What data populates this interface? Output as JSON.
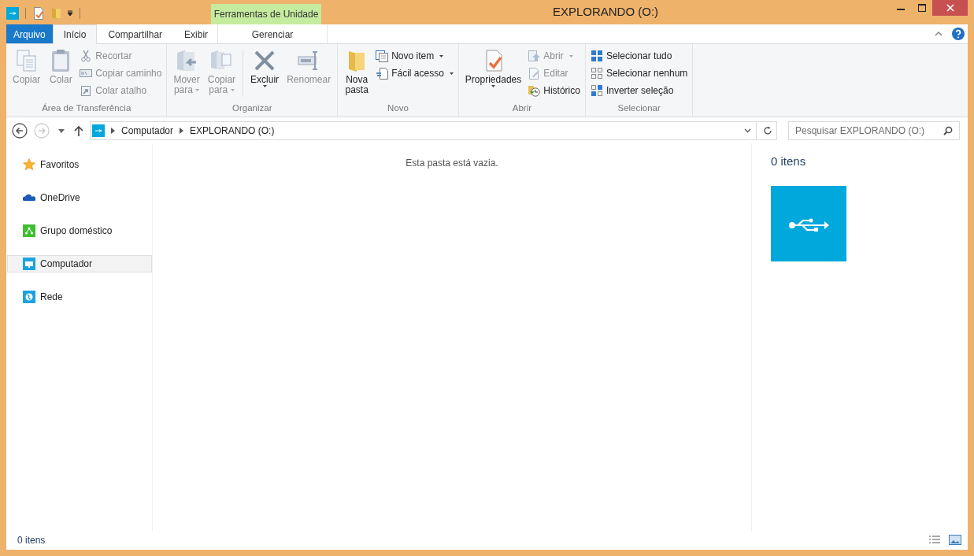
{
  "window": {
    "title": "EXPLORANDO (O:)",
    "context_header": "Ferramentas de Unidade"
  },
  "tabs": [
    {
      "label": "Arquivo",
      "kind": "file",
      "selected": false
    },
    {
      "label": "Início",
      "kind": "tab",
      "selected": true
    },
    {
      "label": "Compartilhar",
      "kind": "tab",
      "selected": false
    },
    {
      "label": "Exibir",
      "kind": "tab",
      "selected": false
    },
    {
      "label": "Gerenciar",
      "kind": "context",
      "selected": false
    }
  ],
  "ribbon": {
    "groups": [
      {
        "label": "Área de Transferência",
        "items": [
          {
            "kind": "large",
            "lines": [
              "Copiar"
            ],
            "disabled": true,
            "dropdown": false
          },
          {
            "kind": "large",
            "lines": [
              "Colar"
            ],
            "disabled": true,
            "dropdown": false
          },
          {
            "kind": "stack",
            "items": [
              {
                "label": "Recortar",
                "disabled": true,
                "dropdown": false
              },
              {
                "label": "Copiar caminho",
                "disabled": true,
                "dropdown": false
              },
              {
                "label": "Colar atalho",
                "disabled": true,
                "dropdown": false
              }
            ]
          }
        ]
      },
      {
        "label": "Organizar",
        "items": [
          {
            "kind": "large",
            "lines": [
              "Mover",
              "para"
            ],
            "disabled": true,
            "dropdown": true
          },
          {
            "kind": "large",
            "lines": [
              "Copiar",
              "para"
            ],
            "disabled": true,
            "dropdown": true
          },
          {
            "kind": "separator"
          },
          {
            "kind": "large",
            "lines": [
              "Excluir"
            ],
            "disabled": false,
            "dropdown": true
          },
          {
            "kind": "large",
            "lines": [
              "Renomear"
            ],
            "disabled": true,
            "dropdown": false
          }
        ]
      },
      {
        "label": "Novo",
        "items": [
          {
            "kind": "large",
            "lines": [
              "Nova",
              "pasta"
            ],
            "disabled": false,
            "dropdown": false
          },
          {
            "kind": "stack",
            "items": [
              {
                "label": "Novo item",
                "disabled": false,
                "dropdown": true
              },
              {
                "label": "Fácil acesso",
                "disabled": false,
                "dropdown": true
              }
            ]
          }
        ]
      },
      {
        "label": "Abrir",
        "items": [
          {
            "kind": "large",
            "lines": [
              "Propriedades"
            ],
            "disabled": false,
            "dropdown": true
          },
          {
            "kind": "stack",
            "items": [
              {
                "label": "Abrir",
                "disabled": true,
                "dropdown": true
              },
              {
                "label": "Editar",
                "disabled": true,
                "dropdown": false
              },
              {
                "label": "Histórico",
                "disabled": false,
                "dropdown": false
              }
            ]
          }
        ]
      },
      {
        "label": "Selecionar",
        "items": [
          {
            "kind": "stack",
            "items": [
              {
                "label": "Selecionar tudo",
                "disabled": false,
                "dropdown": false
              },
              {
                "label": "Selecionar nenhum",
                "disabled": false,
                "dropdown": false
              },
              {
                "label": "Inverter seleção",
                "disabled": false,
                "dropdown": false
              }
            ]
          }
        ]
      }
    ]
  },
  "address_bar": {
    "crumbs": [
      "Computador",
      "EXPLORANDO (O:)"
    ]
  },
  "search": {
    "placeholder": "Pesquisar EXPLORANDO (O:)"
  },
  "navigation": [
    {
      "label": "Favoritos",
      "selected": false
    },
    {
      "label": "OneDrive",
      "selected": false
    },
    {
      "label": "Grupo doméstico",
      "selected": false
    },
    {
      "label": "Computador",
      "selected": true
    },
    {
      "label": "Rede",
      "selected": false
    }
  ],
  "content": {
    "empty_message": "Esta pasta está vazia."
  },
  "details": {
    "count": "0 itens"
  },
  "status_bar": {
    "count": "0 itens"
  }
}
